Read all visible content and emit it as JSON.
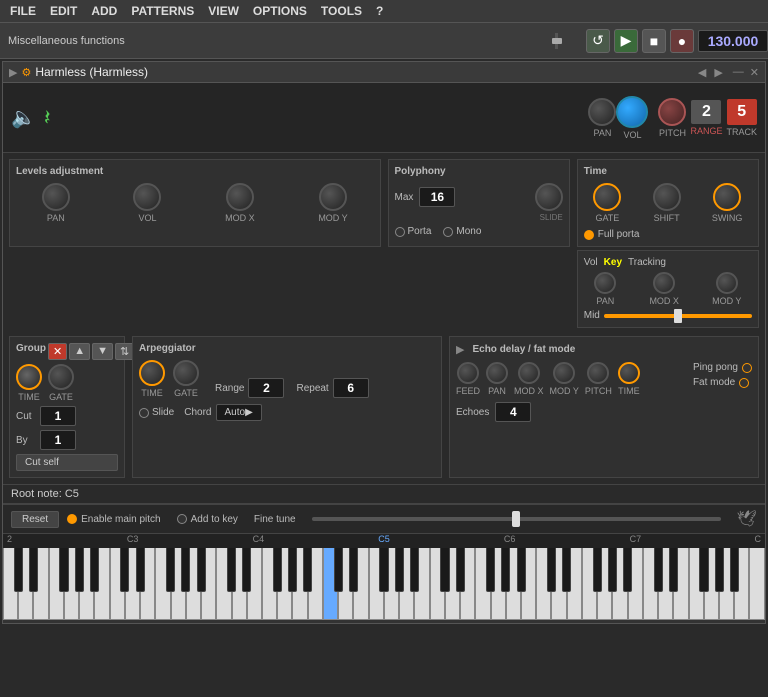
{
  "menubar": {
    "items": [
      "FILE",
      "EDIT",
      "ADD",
      "PATTERNS",
      "VIEW",
      "OPTIONS",
      "TOOLS",
      "?"
    ]
  },
  "misc": {
    "label": "Miscellaneous functions"
  },
  "transport": {
    "bpm": "130.000"
  },
  "plugin": {
    "title": "Harmless (Harmless)",
    "pan_label": "PAN",
    "vol_label": "VOL",
    "pitch_label": "PITCH",
    "range_label": "RANGE",
    "track_label": "TRACK",
    "pitch_value": "2",
    "track_value": "5"
  },
  "levels": {
    "title": "Levels adjustment",
    "knobs": [
      "PAN",
      "VOL",
      "MOD X",
      "MOD Y"
    ]
  },
  "polyphony": {
    "title": "Polyphony",
    "max_label": "Max",
    "max_value": "16",
    "slide_label": "SLIDE",
    "porta_label": "Porta",
    "mono_label": "Mono"
  },
  "time": {
    "title": "Time",
    "knobs": [
      "GATE",
      "SHIFT",
      "SWING"
    ],
    "full_porta_label": "Full porta"
  },
  "vkt": {
    "vol_label": "Vol",
    "key_label": "Key",
    "tracking_label": "Tracking",
    "knobs": [
      "PAN",
      "MOD X",
      "MOD Y"
    ],
    "mid_label": "Mid"
  },
  "group": {
    "title": "Group",
    "cut_label": "Cut",
    "by_label": "By",
    "cut_value": "1",
    "by_value": "1",
    "cut_self_label": "Cut self"
  },
  "arp": {
    "title": "Arpeggiator",
    "knobs": [
      "TIME",
      "GATE"
    ],
    "range_label": "Range",
    "range_value": "2",
    "repeat_label": "Repeat",
    "repeat_value": "6",
    "slide_label": "Slide",
    "chord_label": "Chord",
    "chord_value": "Auto"
  },
  "echo": {
    "title": "Echo delay / fat mode",
    "knobs": [
      "FEED",
      "PAN",
      "MOD X",
      "MOD Y",
      "PITCH",
      "TIME"
    ],
    "echoes_label": "Echoes",
    "echoes_value": "4",
    "ping_pong_label": "Ping pong",
    "fat_mode_label": "Fat mode"
  },
  "root_note": {
    "label": "Root note: C5"
  },
  "fine_tune": {
    "reset_label": "Reset",
    "enable_label": "Enable main pitch",
    "add_to_key_label": "Add to key",
    "fine_tune_label": "Fine tune"
  },
  "piano": {
    "labels": [
      "2",
      "C3",
      "C4",
      "C5",
      "C6",
      "C7",
      "C"
    ],
    "highlighted_key": "C5"
  }
}
